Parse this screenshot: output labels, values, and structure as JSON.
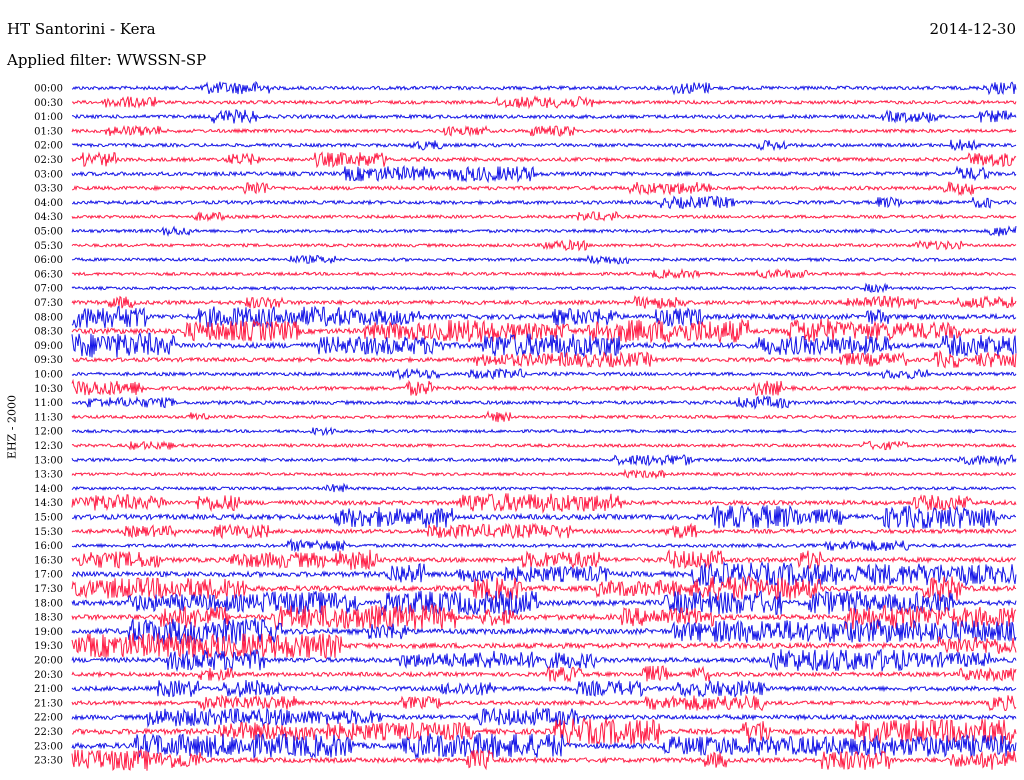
{
  "header": {
    "station": "HT Santorini - Kera",
    "date": "2014-12-30",
    "filter": "Applied filter: WWSSN-SP"
  },
  "channel_label": "EHZ - 2000",
  "colors": {
    "trace_a": "#1414e6",
    "trace_b": "#ff1e46"
  },
  "chart_data": {
    "type": "line",
    "plot_kind": "helicorder",
    "row_labels": [
      "00:00",
      "00:30",
      "01:00",
      "01:30",
      "02:00",
      "02:30",
      "03:00",
      "03:30",
      "04:00",
      "04:30",
      "05:00",
      "05:30",
      "06:00",
      "06:30",
      "07:00",
      "07:30",
      "08:00",
      "08:30",
      "09:00",
      "09:30",
      "10:00",
      "10:30",
      "11:00",
      "11:30",
      "12:00",
      "12:30",
      "13:00",
      "13:30",
      "14:00",
      "14:30",
      "15:00",
      "15:30",
      "16:00",
      "16:30",
      "17:00",
      "17:30",
      "18:00",
      "18:30",
      "19:00",
      "19:30",
      "20:00",
      "20:30",
      "21:00",
      "21:30",
      "22:00",
      "22:30",
      "23:00",
      "23:30"
    ],
    "activity_level": [
      0.35,
      0.3,
      0.35,
      0.3,
      0.3,
      0.4,
      0.45,
      0.4,
      0.35,
      0.2,
      0.25,
      0.2,
      0.2,
      0.2,
      0.15,
      0.5,
      0.8,
      0.9,
      0.95,
      0.5,
      0.3,
      0.45,
      0.35,
      0.2,
      0.15,
      0.2,
      0.3,
      0.15,
      0.15,
      0.6,
      0.85,
      0.5,
      0.3,
      0.7,
      0.85,
      0.9,
      0.9,
      0.9,
      0.95,
      0.9,
      0.75,
      0.55,
      0.6,
      0.5,
      0.65,
      0.95,
      1.0,
      0.7
    ],
    "x_range_minutes": [
      0,
      30
    ],
    "grid": false,
    "legend": "none"
  }
}
